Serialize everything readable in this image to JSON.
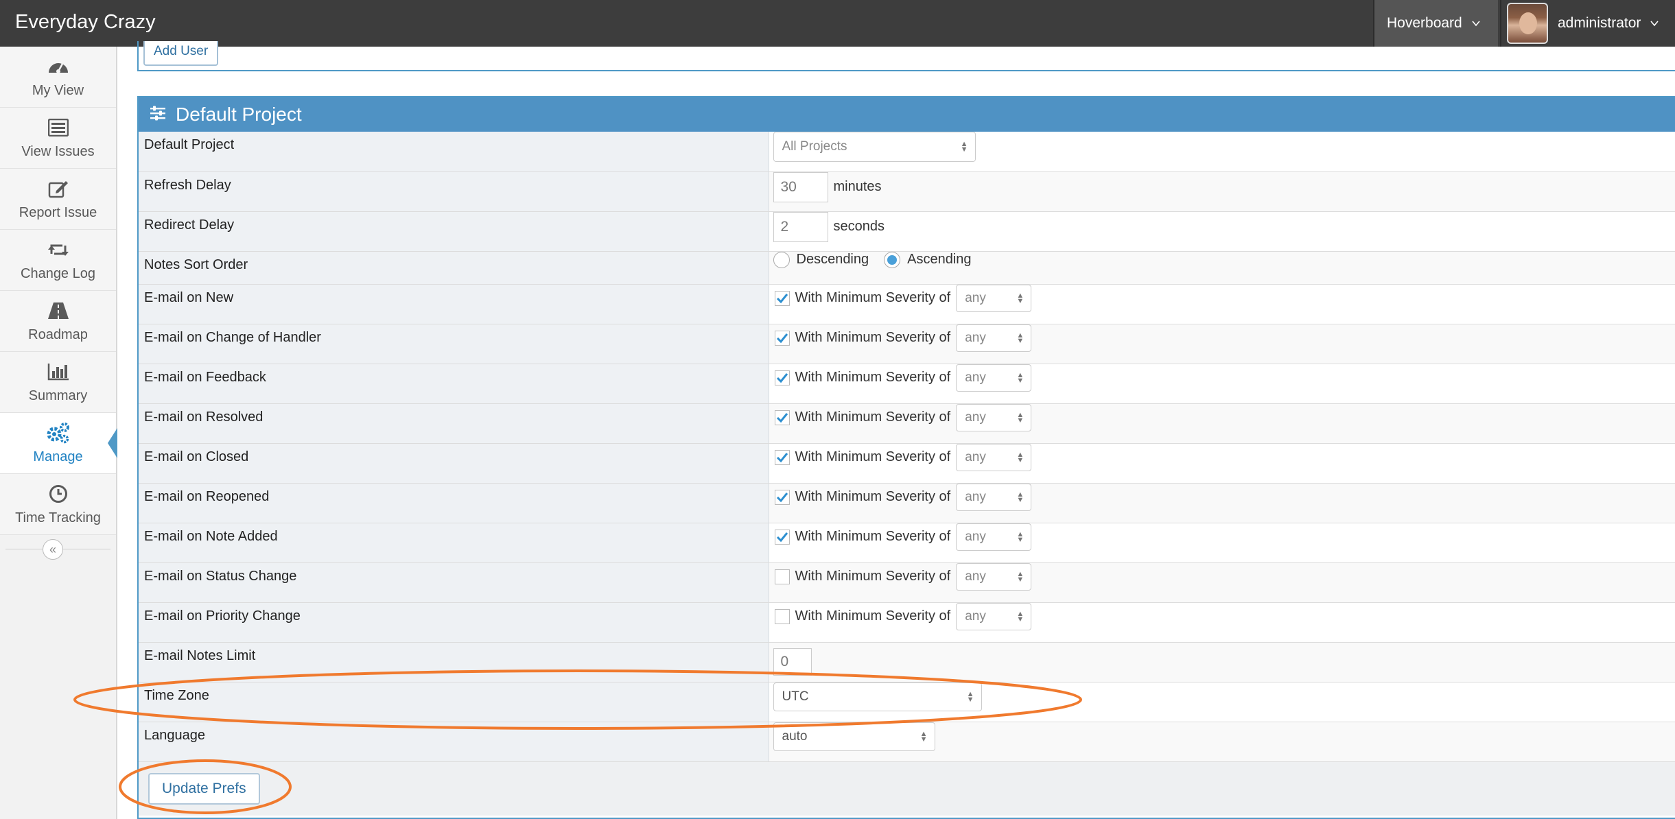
{
  "navbar": {
    "brand": "Everyday Crazy",
    "project_menu": "Hoverboard",
    "user_menu": "administrator"
  },
  "sidebar": {
    "items": [
      {
        "label": "My View",
        "icon": "dashboard-icon"
      },
      {
        "label": "View Issues",
        "icon": "list-icon"
      },
      {
        "label": "Report Issue",
        "icon": "edit-icon"
      },
      {
        "label": "Change Log",
        "icon": "retweet-icon"
      },
      {
        "label": "Roadmap",
        "icon": "road-icon"
      },
      {
        "label": "Summary",
        "icon": "bar-chart-icon"
      },
      {
        "label": "Manage",
        "icon": "gears-icon",
        "active": true
      },
      {
        "label": "Time Tracking",
        "icon": "clock-icon"
      }
    ],
    "collapse": "«"
  },
  "add_user_label": "Add User",
  "widget": {
    "title": "Default Project",
    "rows": {
      "default_project": {
        "label": "Default Project",
        "value": "All Projects"
      },
      "refresh_delay": {
        "label": "Refresh Delay",
        "value": "30",
        "unit": "minutes"
      },
      "redirect_delay": {
        "label": "Redirect Delay",
        "value": "2",
        "unit": "seconds"
      },
      "notes_sort": {
        "label": "Notes Sort Order",
        "opt1": "Descending",
        "opt2": "Ascending",
        "selected": "Ascending"
      },
      "email_notes_limit": {
        "label": "E-mail Notes Limit",
        "value": "0"
      },
      "time_zone": {
        "label": "Time Zone",
        "value": "UTC"
      },
      "language": {
        "label": "Language",
        "value": "auto"
      }
    },
    "email_rows": [
      {
        "label": "E-mail on New",
        "checked": true
      },
      {
        "label": "E-mail on Change of Handler",
        "checked": true
      },
      {
        "label": "E-mail on Feedback",
        "checked": true
      },
      {
        "label": "E-mail on Resolved",
        "checked": true
      },
      {
        "label": "E-mail on Closed",
        "checked": true
      },
      {
        "label": "E-mail on Reopened",
        "checked": true
      },
      {
        "label": "E-mail on Note Added",
        "checked": true
      },
      {
        "label": "E-mail on Status Change",
        "checked": false
      },
      {
        "label": "E-mail on Priority Change",
        "checked": false
      }
    ],
    "severity_text": "With Minimum Severity of",
    "severity_value": "any",
    "update_label": "Update Prefs"
  },
  "colors": {
    "navbar": "#3d3d3d",
    "accent": "#4f92c4",
    "annotation": "#f07a2e"
  }
}
